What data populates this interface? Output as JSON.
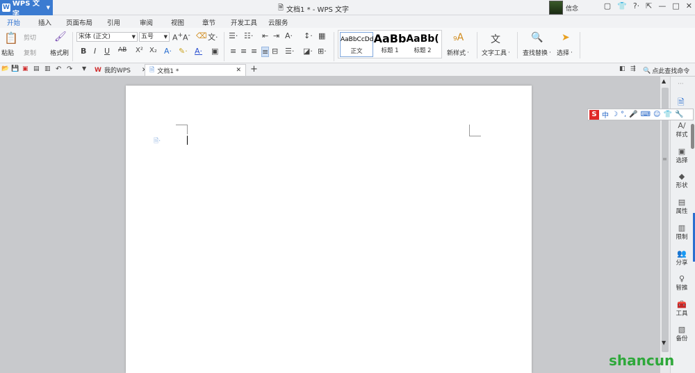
{
  "app": {
    "name": "WPS 文字",
    "icon": "wps-w-icon",
    "accent": "#3b7bd1"
  },
  "window": {
    "title": "文档1 * - WPS 文字",
    "user": "信念"
  },
  "tabs": [
    "开始",
    "插入",
    "页面布局",
    "引用",
    "审阅",
    "视图",
    "章节",
    "开发工具",
    "云服务"
  ],
  "ribbon": {
    "clipboard": {
      "paste": "粘贴",
      "cut": "剪切",
      "copy": "复制",
      "format_painter": "格式刷"
    },
    "font": {
      "family": "宋体 (正文)",
      "size": "五号"
    },
    "format_buttons": [
      "B",
      "I",
      "U",
      "AB",
      "X²",
      "X₂"
    ],
    "styles": [
      {
        "preview": "AaBbCcDd",
        "label": "正文"
      },
      {
        "preview": "AaBb",
        "label": "标题 1"
      },
      {
        "preview": "AaBb(",
        "label": "标题 2"
      }
    ],
    "new_style": "新样式",
    "text_tools": "文字工具",
    "find_replace": "查找替换",
    "select": "选择"
  },
  "doc_tabs": {
    "home": "我的WPS",
    "current": "文档1 *",
    "find_command": "点此查找命令"
  },
  "sidebar": [
    "样式",
    "选择",
    "形状",
    "属性",
    "限制",
    "分享",
    "智推",
    "工具",
    "备份"
  ],
  "ime": {
    "logo": "S",
    "lang": "中"
  },
  "watermark": "shancun"
}
